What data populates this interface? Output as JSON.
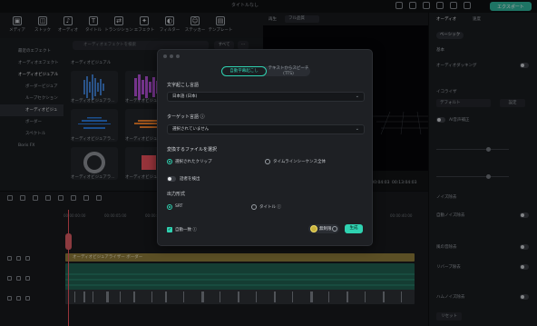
{
  "window": {
    "title": "タイトルなし"
  },
  "export_button": "エクスポート",
  "toolbar": [
    {
      "label": "メディア",
      "icon": "media-icon"
    },
    {
      "label": "ストック",
      "icon": "stock-icon"
    },
    {
      "label": "オーディオ",
      "icon": "audio-icon"
    },
    {
      "label": "タイトル",
      "icon": "text-icon"
    },
    {
      "label": "トランジション",
      "icon": "transition-icon"
    },
    {
      "label": "エフェクト",
      "icon": "effect-icon"
    },
    {
      "label": "フィルター",
      "icon": "filter-icon"
    },
    {
      "label": "ステッカー",
      "icon": "sticker-icon"
    },
    {
      "label": "テンプレート",
      "icon": "template-icon"
    }
  ],
  "library": {
    "search_placeholder": "オーディオエフェクトを検索",
    "filter_label": "すべて",
    "section_title": "オーディオビジュアル",
    "nav": [
      {
        "label": "最近のエフェクト"
      },
      {
        "label": "オーディオエフェクト"
      },
      {
        "label": "オーディオビジュアル"
      },
      {
        "label": "ボーダービジュア"
      },
      {
        "label": "ループセクション"
      },
      {
        "label": "オーディオビジュ"
      },
      {
        "label": "ボーダー"
      },
      {
        "label": "スペクトル"
      },
      {
        "label": "Boris FX"
      }
    ],
    "thumbs": [
      {
        "label": "オーディオビジュアラ..."
      },
      {
        "label": "オーディオビジュアラ..."
      },
      {
        "label": "オーディオビジュアラ..."
      },
      {
        "label": "オーディオビジュアラ..."
      },
      {
        "label": "オーディオビジュアラ..."
      },
      {
        "label": "オーディオビジュアラ..."
      }
    ]
  },
  "preview": {
    "label": "再生",
    "quality": "フル品質",
    "time_current": "00:00:04:03",
    "time_total": "00:13:04:03"
  },
  "inspector": {
    "tabs": [
      "オーディオ",
      "速度"
    ],
    "subtab": "ベーシック",
    "rows": [
      {
        "label": "基本"
      },
      {
        "label": "オーディオダッキング"
      },
      {
        "label": "イコライザ"
      },
      {
        "label": "デフォルト"
      },
      {
        "label": "設定"
      },
      {
        "label": "AI音声補正"
      },
      {
        "label": "ノイズ除去"
      },
      {
        "label": "自動ノイズ除去"
      },
      {
        "label": "風の音除去"
      },
      {
        "label": "リバーブ除去"
      },
      {
        "label": "ハムノイズ除去"
      },
      {
        "label": "リセット"
      }
    ]
  },
  "timeline": {
    "ruler": [
      "00:00:00:00",
      "00:00:05:00",
      "00:00:10:00",
      "00:00:15:00",
      "00:00:20:00",
      "00:00:25:00",
      "00:00:30:00",
      "00:00:35:00",
      "00:00:40:00"
    ],
    "title_clip": "オーディオビジュアライザー ボーダー"
  },
  "modal": {
    "tabs": [
      "自動字幕起こし",
      "テキストからスピーチ\n(TTS)"
    ],
    "lang_label": "文字起こし言語",
    "lang_value": "日本語 (日本)",
    "target_label": "ターゲット言語 ⓘ",
    "target_value": "選択されていません",
    "file_label": "変換するファイルを選択",
    "radio_selected_clip": "選択されたクリップ",
    "radio_timeline": "タイムラインシーケンス全体",
    "speaker_label": "話者を検出",
    "output_label": "出力形式",
    "format_srt": "SRT",
    "format_title": "タイトル ⓘ",
    "auto_match": "自動一致 ⓘ",
    "credits": "無制限",
    "generate": "生成"
  }
}
